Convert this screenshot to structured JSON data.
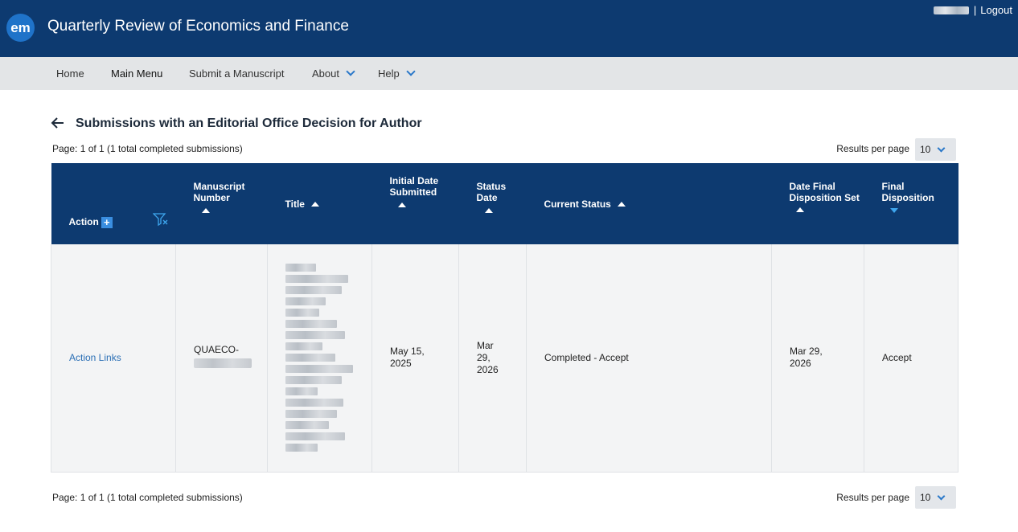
{
  "header": {
    "logo_text": "em",
    "journal_title": "Quarterly Review of Economics and Finance",
    "separator": "|",
    "logout_label": "Logout"
  },
  "nav": {
    "items": [
      {
        "label": "Home"
      },
      {
        "label": "Main Menu"
      },
      {
        "label": "Submit a Manuscript"
      },
      {
        "label": "About"
      },
      {
        "label": "Help"
      }
    ]
  },
  "page": {
    "heading": "Submissions with an Editorial Office Decision for Author",
    "pager_top": "Page: 1 of 1 (1 total completed submissions)",
    "pager_bottom": "Page: 1 of 1 (1 total completed submissions)",
    "results_per_page_label": "Results per page",
    "results_per_page_value": "10"
  },
  "table": {
    "columns": [
      {
        "label": "Action"
      },
      {
        "label": "Manuscript Number"
      },
      {
        "label": "Title"
      },
      {
        "label": "Initial Date Submitted"
      },
      {
        "label": "Status Date"
      },
      {
        "label": "Current Status"
      },
      {
        "label": "Date Final Disposition Set"
      },
      {
        "label": "Final Disposition"
      }
    ],
    "action_plus": "+",
    "rows": [
      {
        "action": "Action Links",
        "manuscript_prefix": "QUAECO-",
        "initial_date": "May 15, 2025",
        "status_date": "Mar 29, 2026",
        "current_status": "Completed - Accept",
        "date_final_disposition": "Mar 29, 2026",
        "final_disposition": "Accept"
      }
    ]
  },
  "colors": {
    "header_bg": "#0d3a70",
    "nav_bg": "#e3e5e7",
    "link": "#2b6fb5",
    "accent": "#3a8ee0"
  }
}
